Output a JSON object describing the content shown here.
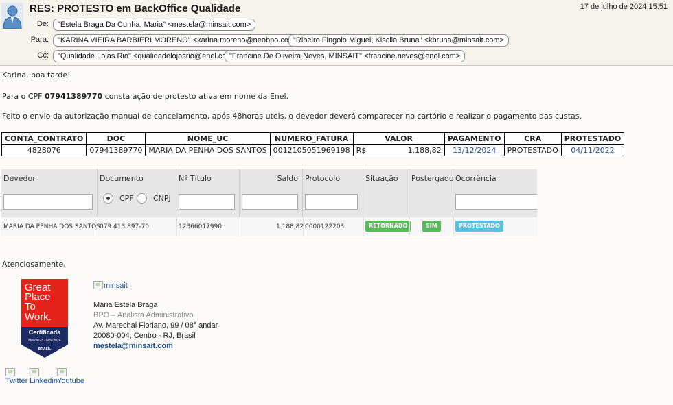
{
  "header": {
    "subject": "RES: PROTESTO em BackOffice Qualidade",
    "date": "17 de julho de 2024 15:51",
    "from_label": "De:",
    "from": [
      "\"Estela Braga Da Cunha, Maria\" <mestela@minsait.com>"
    ],
    "to_label": "Para:",
    "to": [
      "\"KARINA VIEIRA BARBIERI MORENO\" <karina.moreno@neobpo.com.br>",
      "\"Ribeiro Fingolo Miguel, Kiscila Bruna\" <kbruna@minsait.com>"
    ],
    "cc_label": "Cc:",
    "cc": [
      "\"Qualidade Lojas Rio\" <qualidadelojasrio@enel.com>",
      "\"Francine De Oliveira Neves, MINSAIT\" <francine.neves@enel.com>"
    ]
  },
  "body": {
    "greeting": "Karina, boa tarde!",
    "p1_pre": "Para o CPF ",
    "p1_cpf": "07941389770",
    "p1_post": " consta ação de protesto ativa em nome da Enel.",
    "p2": "Feito o envio da autorização manual de cancelamento, após 48horas uteis, o devedor deverá comparecer no cartório  e realizar o pagamento das custas.",
    "closing": "Atenciosamente,"
  },
  "table": {
    "headers": [
      "CONTA_CONTRATO",
      "DOC",
      "NOME_UC",
      "NUMERO_FATURA",
      "VALOR",
      "PAGAMENTO",
      "CRA",
      "PROTESTADO"
    ],
    "row": {
      "conta": "4828076",
      "doc": "07941389770",
      "nome": "MARIA DA PENHA DOS SANTOS",
      "fatura": "0012105051969198",
      "currency": "R$",
      "valor": "1.188,82",
      "pagamento": "13/12/2024",
      "cra": "PROTESTADO",
      "protestado": "04/11/2022"
    }
  },
  "grid": {
    "headers": {
      "devedor": "Devedor",
      "documento": "Documento",
      "titulo": "Nº Título",
      "saldo": "Saldo",
      "protocolo": "Protocolo",
      "situacao": "Situação",
      "postergado": "Postergado",
      "ocorrencia": "Ocorrência"
    },
    "radio_cpf": "CPF",
    "radio_cnpj": "CNPJ",
    "row": {
      "devedor": "MARIA DA PENHA DOS SANTOS",
      "documento": "079.413.897-70",
      "titulo": "12366017990",
      "saldo": "1.188,82",
      "protocolo": "0000122203",
      "situacao": "RETORNADO",
      "postergado": "SIM",
      "ocorrencia": "PROTESTADO"
    }
  },
  "signature": {
    "logo_alt": "minsait",
    "name": "Maria Estela Braga",
    "role": "BPO – Analista Administrativo",
    "address1": "Av. Marechal Floriano, 99 / 08° andar",
    "address2": "20080-004, Centro - RJ, Brasil",
    "email": "mestela@minsait.com",
    "badge": {
      "line1": "Great",
      "line2": "Place",
      "line3": "To",
      "line4": "Work.",
      "cert": "Certificada",
      "period": "Nov/2023 - Nov/2024",
      "country": "BRASIL"
    },
    "social": [
      "Twitter",
      "Linkedin",
      "Youtube"
    ]
  },
  "colors": {
    "header_bg": "#f5f3ec",
    "badge_green": "#5cb85c",
    "badge_blue": "#5bc0de",
    "gptw_red": "#e5231b",
    "gptw_navy": "#1d2a63",
    "link_blue": "#1a4fa0"
  }
}
